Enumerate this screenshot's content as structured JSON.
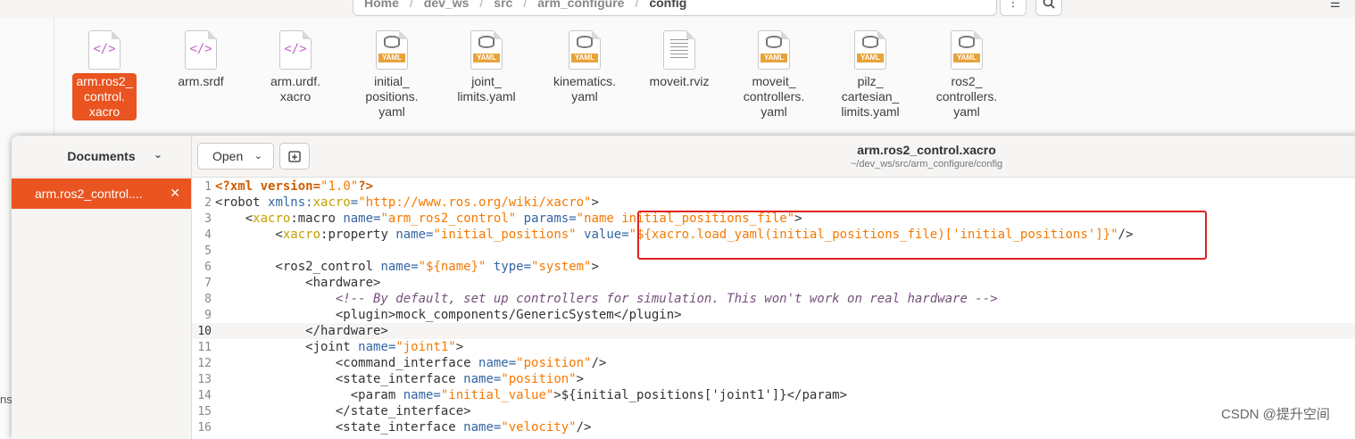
{
  "file_manager": {
    "path": [
      "Home",
      "dev_ws",
      "src",
      "arm_configure",
      "config"
    ],
    "menu_icon": "kebab-menu-icon",
    "search_icon": "search-icon",
    "files": [
      {
        "label": "arm.ros2_\ncontrol.\nxacro",
        "icon": "xml-file-icon",
        "selected": true
      },
      {
        "label": "arm.srdf",
        "icon": "xml-file-icon",
        "selected": false
      },
      {
        "label": "arm.urdf.\nxacro",
        "icon": "xml-file-icon",
        "selected": false
      },
      {
        "label": "initial_\npositions.\nyaml",
        "icon": "yaml-file-icon",
        "selected": false
      },
      {
        "label": "joint_\nlimits.yaml",
        "icon": "yaml-file-icon",
        "selected": false
      },
      {
        "label": "kinematics.\nyaml",
        "icon": "yaml-file-icon",
        "selected": false
      },
      {
        "label": "moveit.rviz",
        "icon": "text-file-icon",
        "selected": false
      },
      {
        "label": "moveit_\ncontrollers.\nyaml",
        "icon": "yaml-file-icon",
        "selected": false
      },
      {
        "label": "pilz_\ncartesian_\nlimits.yaml",
        "icon": "yaml-file-icon",
        "selected": false
      },
      {
        "label": "ros2_\ncontrollers.\nyaml",
        "icon": "yaml-file-icon",
        "selected": false
      }
    ],
    "bottom_left_text": "ns",
    "yaml_tag": "YAML",
    "xml_glyph": "</>"
  },
  "editor": {
    "sidebar_title": "Documents",
    "open_document": "arm.ros2_control....",
    "open_button": "Open",
    "title": "arm.ros2_control.xacro",
    "subtitle": "~/dev_ws/src/arm_configure/config",
    "current_line": 10,
    "lines": [
      {
        "n": "1",
        "html": "<span class='t-pi'>&lt;?xml</span> <span class='t-pi'>version=</span><span class='t-val'>\"1.0\"</span><span class='t-pi'>?&gt;</span>"
      },
      {
        "n": "2",
        "html": "&lt;robot <span class='t-attr'>xmlns:</span><span class='t-ns'>xacro</span><span class='t-attr'>=</span><span class='t-val'>\"http://www.ros.org/wiki/xacro\"</span>&gt;"
      },
      {
        "n": "3",
        "html": "    &lt;<span class='t-ns'>xacro</span>:macro <span class='t-attr'>name=</span><span class='t-val'>\"arm_ros2_control\"</span> <span class='t-attr'>params=</span><span class='t-val'>\"name initial_positions_file\"</span>&gt;"
      },
      {
        "n": "4",
        "html": "        &lt;<span class='t-ns'>xacro</span>:property <span class='t-attr'>name=</span><span class='t-val'>\"initial_positions\"</span> <span class='t-attr'>value=</span><span class='t-val'>\"${xacro.load_yaml(initial_positions_file)['initial_positions']}\"</span>/&gt;"
      },
      {
        "n": "5",
        "html": ""
      },
      {
        "n": "6",
        "html": "        &lt;ros2_control <span class='t-attr'>name=</span><span class='t-val'>\"${name}\"</span> <span class='t-attr'>type=</span><span class='t-val'>\"system\"</span>&gt;"
      },
      {
        "n": "7",
        "html": "            &lt;hardware&gt;"
      },
      {
        "n": "8",
        "html": "                <span class='t-com'>&lt;!-- By default, set up controllers for simulation. This won't work on real hardware --&gt;</span>"
      },
      {
        "n": "9",
        "html": "                &lt;plugin&gt;mock_components/GenericSystem&lt;/plugin&gt;"
      },
      {
        "n": "10",
        "html": "            &lt;/hardware&gt;"
      },
      {
        "n": "11",
        "html": "            &lt;joint <span class='t-attr'>name=</span><span class='t-val'>\"joint1\"</span>&gt;"
      },
      {
        "n": "12",
        "html": "                &lt;command_interface <span class='t-attr'>name=</span><span class='t-val'>\"position\"</span>/&gt;"
      },
      {
        "n": "13",
        "html": "                &lt;state_interface <span class='t-attr'>name=</span><span class='t-val'>\"position\"</span>&gt;"
      },
      {
        "n": "14",
        "html": "                  &lt;param <span class='t-attr'>name=</span><span class='t-val'>\"initial_value\"</span>&gt;${initial_positions['joint1']}&lt;/param&gt;"
      },
      {
        "n": "15",
        "html": "                &lt;/state_interface&gt;"
      },
      {
        "n": "16",
        "html": "                &lt;state_interface <span class='t-attr'>name=</span><span class='t-val'>\"velocity\"</span>/&gt;"
      }
    ]
  },
  "watermark": "CSDN @提升空间",
  "colors": {
    "accent": "#e95420",
    "highlight_box": "#e02020"
  }
}
